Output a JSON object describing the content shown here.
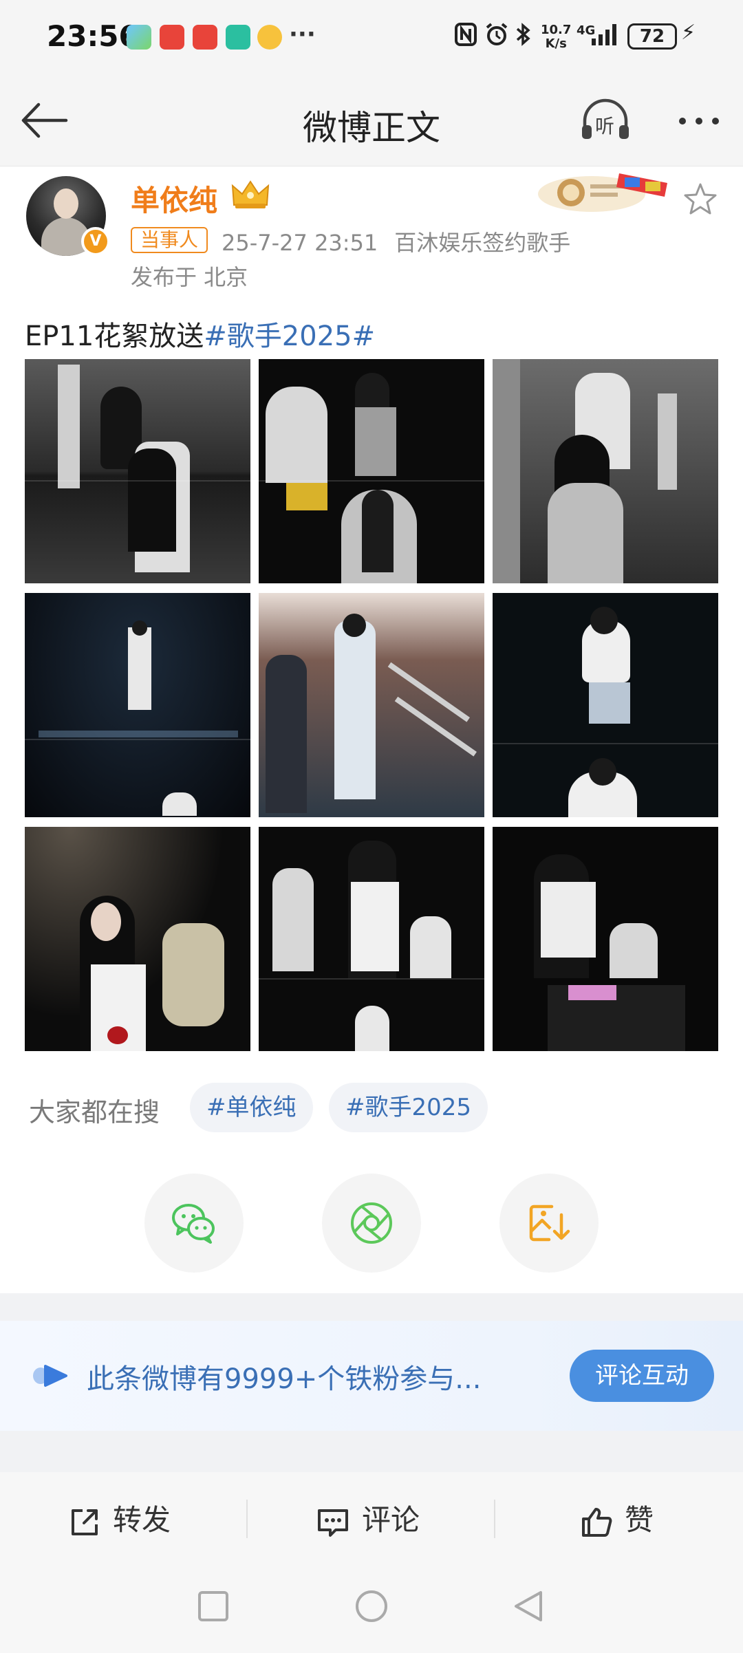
{
  "status_bar": {
    "time": "23:56",
    "more_dots": "···",
    "net_speed_value": "10.7",
    "net_speed_unit": "K/s",
    "network": "4G",
    "battery": "72",
    "icons": [
      "nfc-icon",
      "alarm-icon",
      "bluetooth-icon",
      "signal-icon",
      "charging-icon"
    ]
  },
  "nav": {
    "title": "微博正文",
    "listen_label": "听"
  },
  "post": {
    "author": "单依纯",
    "verified_badge": "V",
    "tag": "当事人",
    "datetime": "25-7-27 23:51",
    "source": "百沐娱乐签约歌手",
    "location": "发布于 北京",
    "text_plain": "EP11花絮放送",
    "text_topic": "#歌手2025#",
    "image_count": 9
  },
  "search": {
    "label": "大家都在搜",
    "chips": [
      "#单依纯",
      "#歌手2025"
    ]
  },
  "share": {
    "buttons": [
      "wechat-icon",
      "moments-icon",
      "save-image-icon"
    ]
  },
  "fan_banner": {
    "text": "此条微博有9999+个铁粉参与...",
    "button": "评论互动"
  },
  "actions": {
    "repost": "转发",
    "comment": "评论",
    "like": "赞"
  },
  "colors": {
    "accent_blue": "#3a6fb5",
    "author_orange": "#f07d1a",
    "button_blue": "#4a8fe0",
    "wechat_green": "#4cc45d",
    "save_orange": "#f2a524"
  }
}
